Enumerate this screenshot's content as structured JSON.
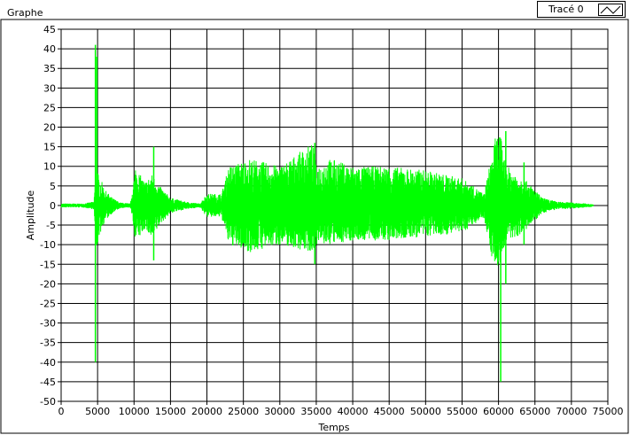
{
  "window": {
    "title": "Graphe"
  },
  "legend": {
    "label": "Tracé 0"
  },
  "colors": {
    "trace": "#00ff00",
    "grid": "#000000",
    "background": "#ffffff"
  },
  "chart_data": {
    "type": "line",
    "title": "",
    "xlabel": "Temps",
    "ylabel": "Amplitude",
    "xlim": [
      0,
      75000
    ],
    "ylim": [
      -50,
      45
    ],
    "xticks": [
      0,
      5000,
      10000,
      15000,
      20000,
      25000,
      30000,
      35000,
      40000,
      45000,
      50000,
      55000,
      60000,
      65000,
      70000,
      75000
    ],
    "yticks": [
      45,
      40,
      35,
      30,
      25,
      20,
      15,
      10,
      5,
      0,
      -5,
      -10,
      -15,
      -20,
      -25,
      -30,
      -35,
      -40,
      -45,
      -50
    ],
    "grid": true,
    "series": [
      {
        "name": "Tracé 0",
        "envelope": {
          "x": [
            0,
            3000,
            4500,
            4800,
            5200,
            5600,
            6000,
            7000,
            8000,
            9500,
            10200,
            10800,
            11500,
            12500,
            13500,
            15000,
            17000,
            19000,
            20000,
            22000,
            23000,
            26000,
            30000,
            34500,
            35000,
            37000,
            40000,
            45000,
            50000,
            55000,
            58000,
            59500,
            60200,
            60600,
            61200,
            62500,
            64000,
            66000,
            68000,
            70000,
            72000,
            73000
          ],
          "upper": [
            0.5,
            0.5,
            1,
            11,
            7,
            6,
            4,
            2,
            0.8,
            0.5,
            10,
            8,
            6,
            8,
            5,
            2,
            1,
            0.5,
            3,
            3,
            10,
            12,
            10,
            16,
            10,
            12,
            10,
            10,
            9,
            7,
            3,
            17,
            19,
            14,
            10,
            8,
            6,
            2,
            1,
            0.8,
            0.5,
            0.3
          ],
          "lower": [
            -0.5,
            -0.5,
            -1,
            -12,
            -8,
            -6,
            -4,
            -2,
            -0.8,
            -0.5,
            -9,
            -8,
            -6,
            -9,
            -5,
            -2,
            -1,
            -0.5,
            -3,
            -3,
            -10,
            -12,
            -10,
            -12,
            -10,
            -10,
            -9,
            -9,
            -8,
            -7,
            -3,
            -17,
            -15,
            -12,
            -9,
            -8,
            -6,
            -2,
            -1,
            -0.8,
            -0.5,
            -0.3
          ]
        },
        "spikes": [
          {
            "x": 4700,
            "high": 41,
            "low": -40
          },
          {
            "x": 4900,
            "high": 38,
            "low": -10
          },
          {
            "x": 12700,
            "high": 15,
            "low": -14
          },
          {
            "x": 34800,
            "high": 16,
            "low": -15
          },
          {
            "x": 60300,
            "high": 17,
            "low": -45
          },
          {
            "x": 61000,
            "high": 19,
            "low": -20
          },
          {
            "x": 63500,
            "high": 11,
            "low": -10
          }
        ]
      }
    ]
  }
}
